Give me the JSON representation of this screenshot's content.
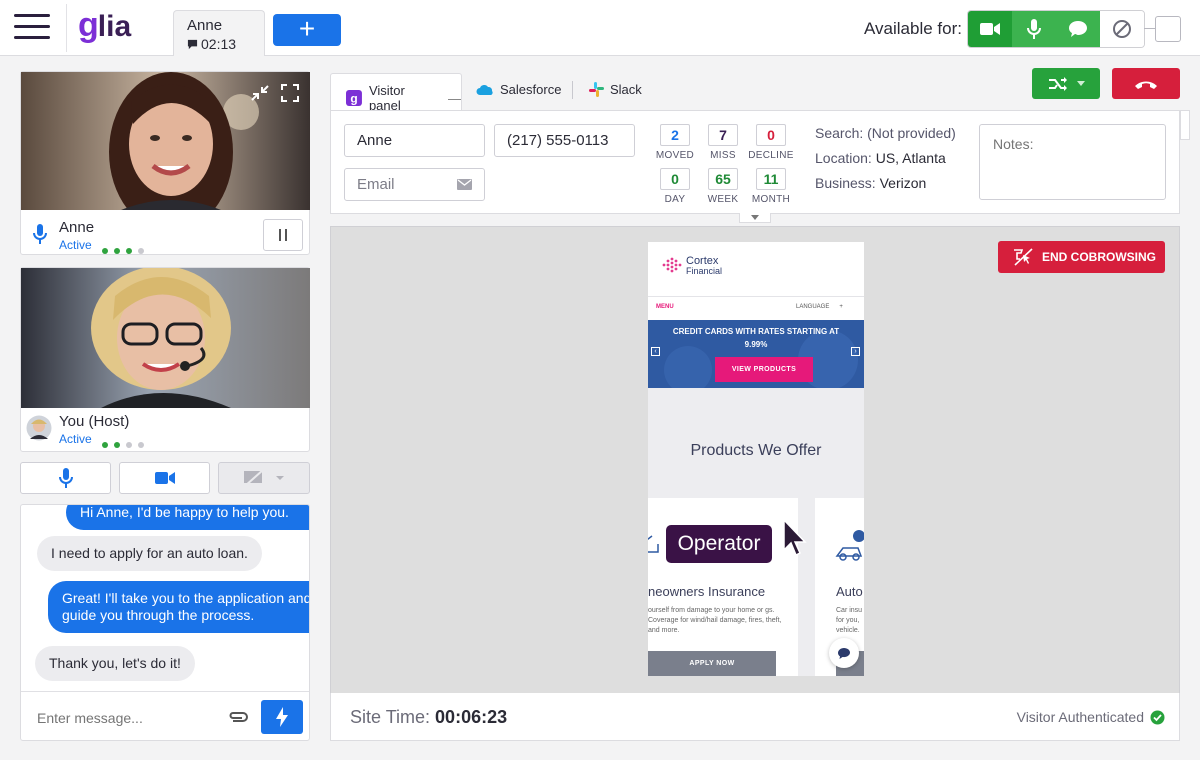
{
  "brand": {
    "logo_g": "g",
    "logo_text": "lia"
  },
  "session_tab": {
    "name": "Anne",
    "timer": "02:13"
  },
  "new_button": "+",
  "availability": {
    "label": "Available for:"
  },
  "left": {
    "visitor_video": {
      "name": "Anne",
      "status": "Active"
    },
    "host_video": {
      "name": "You (Host)",
      "status": "Active"
    },
    "chat": {
      "messages": [
        {
          "from": "operator",
          "text": "Hi Anne, I'd be happy to help you."
        },
        {
          "from": "visitor",
          "text": "I need to apply for an auto loan."
        },
        {
          "from": "operator",
          "text": "Great! I'll take you to the application and guide you through the process."
        },
        {
          "from": "visitor",
          "text": "Thank you, let's do it!"
        }
      ],
      "placeholder": "Enter message..."
    }
  },
  "panel_tabs": {
    "visitor": "Visitor panel",
    "salesforce": "Salesforce",
    "slack": "Slack"
  },
  "visitor": {
    "name": "Anne",
    "phone": "(217) 555-0113",
    "email_placeholder": "Email",
    "stats": [
      {
        "value": "2",
        "label": "MOVED",
        "color": "#1a73e8"
      },
      {
        "value": "7",
        "label": "MISS",
        "color": "#3a1f55"
      },
      {
        "value": "0",
        "label": "DECLINE",
        "color": "#d61f3c"
      },
      {
        "value": "0",
        "label": "DAY",
        "color": "#1f8a36"
      },
      {
        "value": "65",
        "label": "WEEK",
        "color": "#1f8a36"
      },
      {
        "value": "11",
        "label": "MONTH",
        "color": "#1f8a36"
      }
    ],
    "search": "Search: (Not provided)",
    "location_label": "Location:",
    "location": "US, Atlanta",
    "business_label": "Business:",
    "business": "Verizon",
    "notes_placeholder": "Notes:"
  },
  "cobrowse": {
    "end_button": "END COBROWSING",
    "site_logo_1": "Cortex",
    "site_logo_2": "Financial",
    "menu": "MENU",
    "language": "LANGUAGE",
    "banner_text": "CREDIT CARDS WITH RATES STARTING AT 9.99%",
    "banner_button": "VIEW PRODUCTS",
    "heading": "Products We Offer",
    "card1_title": "neowners Insurance",
    "card1_text": "ourself from damage to your home or gs. Coverage for wind/hail damage, fires, theft, and more.",
    "card1_button": "APPLY NOW",
    "card2_title": "Auto",
    "card2_text": "Car insu for you, vehicle.",
    "operator_label": "Operator"
  },
  "footer": {
    "site_time_label": "Site Time:",
    "site_time": "00:06:23",
    "auth": "Visitor Authenticated"
  },
  "colors": {
    "accent": "#1a73e8",
    "green": "#1f9e35",
    "danger": "#d61f3c",
    "brand": "#7c2fd6"
  }
}
